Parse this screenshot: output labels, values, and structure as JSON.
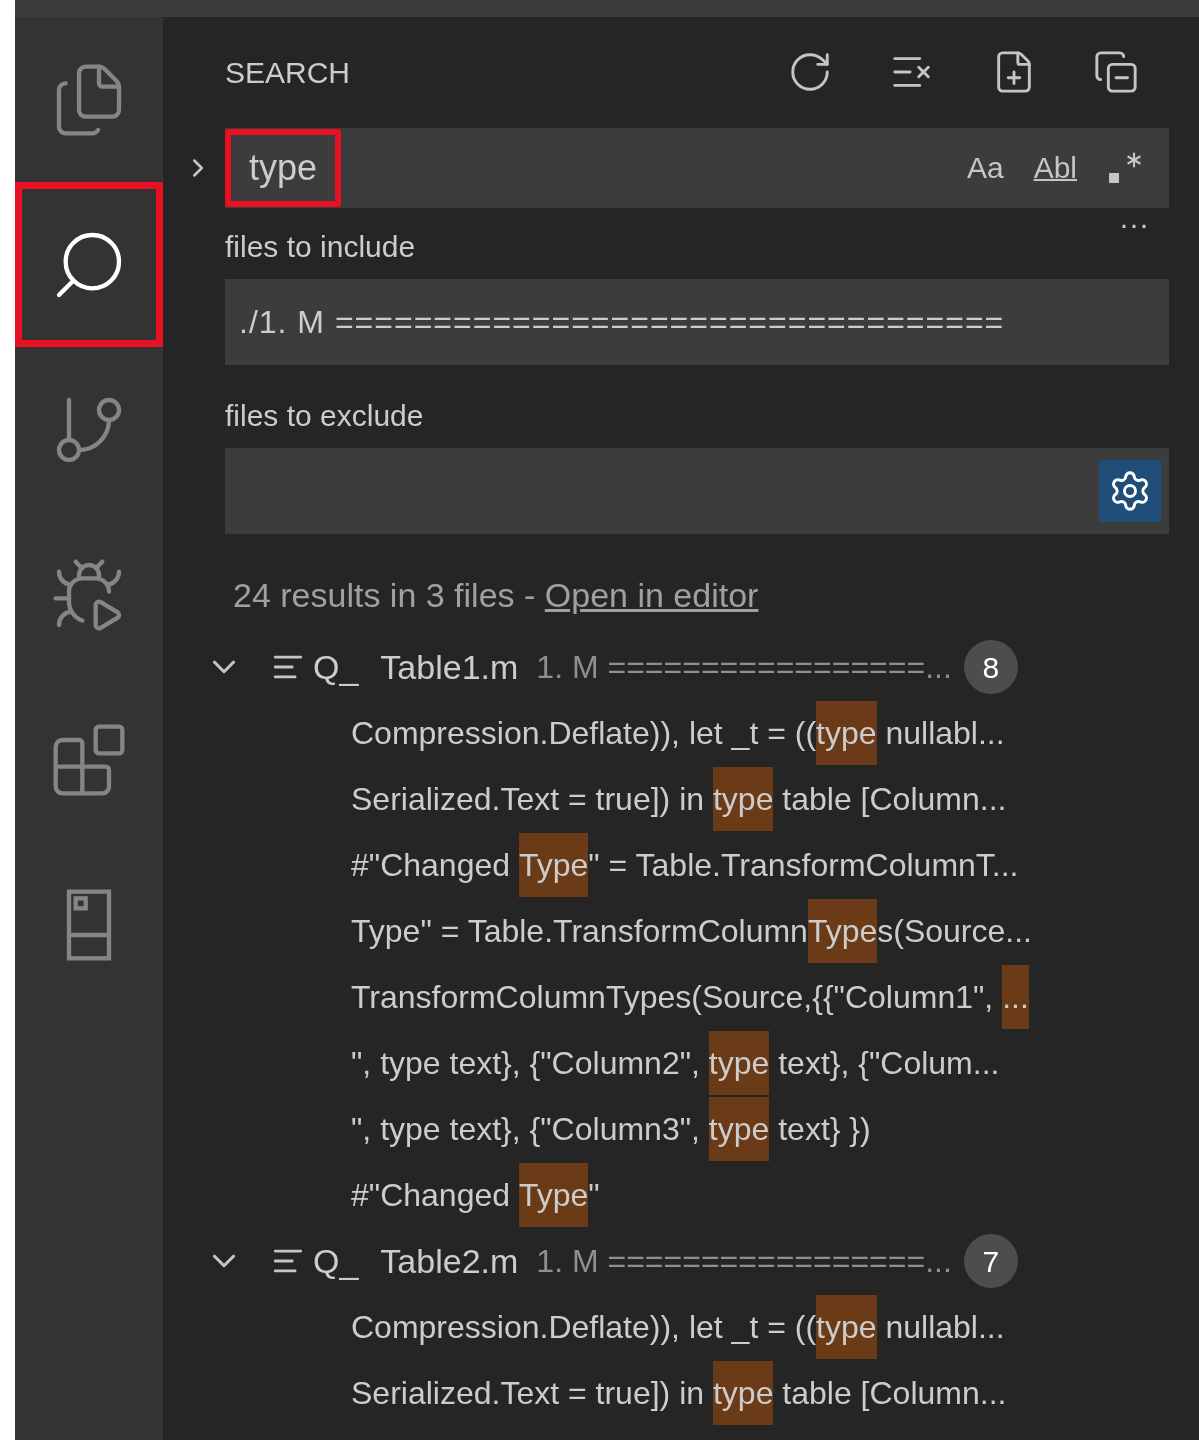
{
  "activity_bar": [
    {
      "kind": "files",
      "selected": false,
      "outlined": false
    },
    {
      "kind": "search",
      "selected": true,
      "outlined": true
    },
    {
      "kind": "source-control",
      "selected": false,
      "outlined": false
    },
    {
      "kind": "run-debug",
      "selected": false,
      "outlined": false
    },
    {
      "kind": "extensions",
      "selected": false,
      "outlined": false
    },
    {
      "kind": "panel",
      "selected": false,
      "outlined": false
    }
  ],
  "sidebar": {
    "title": "SEARCH",
    "actions": [
      {
        "kind": "refresh"
      },
      {
        "kind": "clear"
      },
      {
        "kind": "new-editor"
      },
      {
        "kind": "collapse"
      }
    ]
  },
  "search": {
    "replace_expanded": false,
    "query": "type",
    "query_outlined": true,
    "toggles": [
      {
        "kind": "text",
        "label": "Aa",
        "on": false
      },
      {
        "kind": "text",
        "label": "Abl",
        "on": false
      },
      {
        "kind": "regex",
        "on": false
      }
    ],
    "more": "···",
    "include_label": "files to include",
    "include_value": "./1. M ==================================",
    "exclude_label": "files to exclude",
    "exclude_settings_on": true
  },
  "summary": {
    "text": "24 results in 3 files - ",
    "link": "Open in editor"
  },
  "results": [
    {
      "prefix": "Q_",
      "file": "Table1.m",
      "path": "1. M =================...",
      "count": "8",
      "expanded": true,
      "matches": [
        [
          {
            "text": "Compression.Deflate)), let _t = ((",
            "match": false
          },
          {
            "text": "type",
            "match": true
          },
          {
            "text": " nullabl...",
            "match": false
          }
        ],
        [
          {
            "text": "Serialized.Text = true]) in ",
            "match": false
          },
          {
            "text": "type",
            "match": true
          },
          {
            "text": " table [Column...",
            "match": false
          }
        ],
        [
          {
            "text": "#\"Changed ",
            "match": false
          },
          {
            "text": "Type",
            "match": true
          },
          {
            "text": "\" = Table.TransformColumnT...",
            "match": false
          }
        ],
        [
          {
            "text": "Type\" = Table.TransformColumn",
            "match": false
          },
          {
            "text": "Type",
            "match": true
          },
          {
            "text": "s(Source...",
            "match": false
          }
        ],
        [
          {
            "text": "TransformColumnTypes(Source,{{\"Column1\", ",
            "match": false
          },
          {
            "text": "...",
            "match": true
          }
        ],
        [
          {
            "text": "\", type text}, {\"Column2\", ",
            "match": false
          },
          {
            "text": "type",
            "match": true
          },
          {
            "text": " text}, {\"Colum...",
            "match": false
          }
        ],
        [
          {
            "text": "\", type text}, {\"Column3\", ",
            "match": false
          },
          {
            "text": "type",
            "match": true
          },
          {
            "text": " text} })",
            "match": false
          }
        ],
        [
          {
            "text": "#\"Changed ",
            "match": false
          },
          {
            "text": "Type",
            "match": true
          },
          {
            "text": "\"",
            "match": false
          }
        ]
      ]
    },
    {
      "prefix": "Q_",
      "file": "Table2.m",
      "path": "1. M =================...",
      "count": "7",
      "expanded": true,
      "matches": [
        [
          {
            "text": "Compression.Deflate)), let _t = ((",
            "match": false
          },
          {
            "text": "type",
            "match": true
          },
          {
            "text": " nullabl...",
            "match": false
          }
        ],
        [
          {
            "text": "Serialized.Text = true]) in ",
            "match": false
          },
          {
            "text": "type",
            "match": true
          },
          {
            "text": " table [Column...",
            "match": false
          }
        ]
      ]
    }
  ]
}
